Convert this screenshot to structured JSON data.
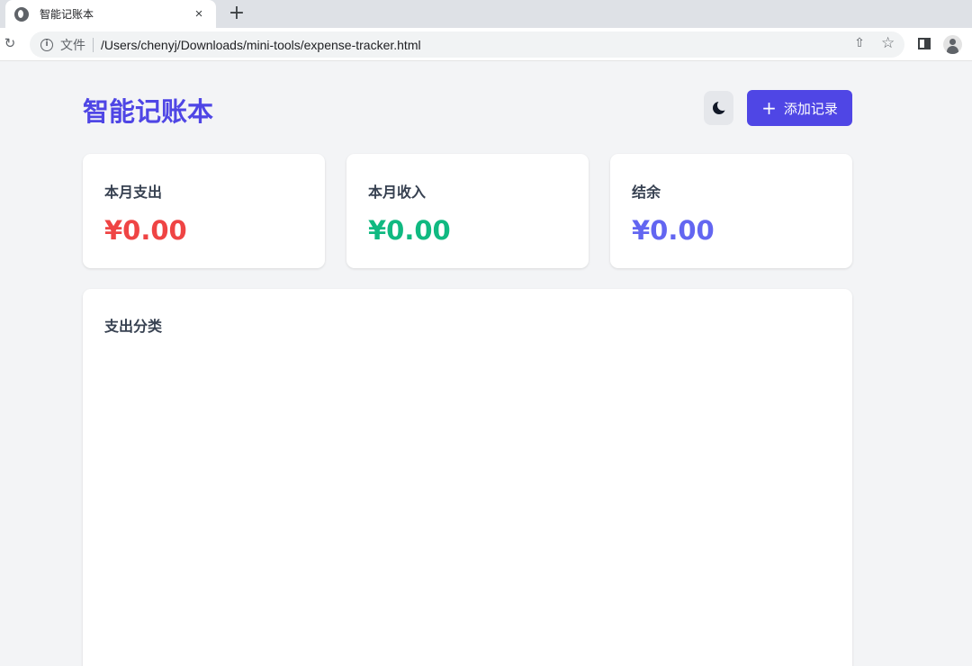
{
  "browser": {
    "tab_title": "智能记账本",
    "tab_close": "×",
    "new_tab": "+",
    "file_label": "文件",
    "url": "/Users/chenyj/Downloads/mini-tools/expense-tracker.html"
  },
  "header": {
    "title": "智能记账本",
    "add_button_label": "添加记录",
    "add_button_icon": "plus-icon",
    "theme_toggle_icon": "moon-icon"
  },
  "summary": {
    "expense": {
      "label": "本月支出",
      "value": "¥0.00",
      "color": "#ef4444"
    },
    "income": {
      "label": "本月收入",
      "value": "¥0.00",
      "color": "#10b981"
    },
    "balance": {
      "label": "结余",
      "value": "¥0.00",
      "color": "#6366f1"
    }
  },
  "category_panel": {
    "title": "支出分类"
  },
  "colors": {
    "accent": "#4f46e5",
    "page_bg": "#f3f4f6"
  }
}
